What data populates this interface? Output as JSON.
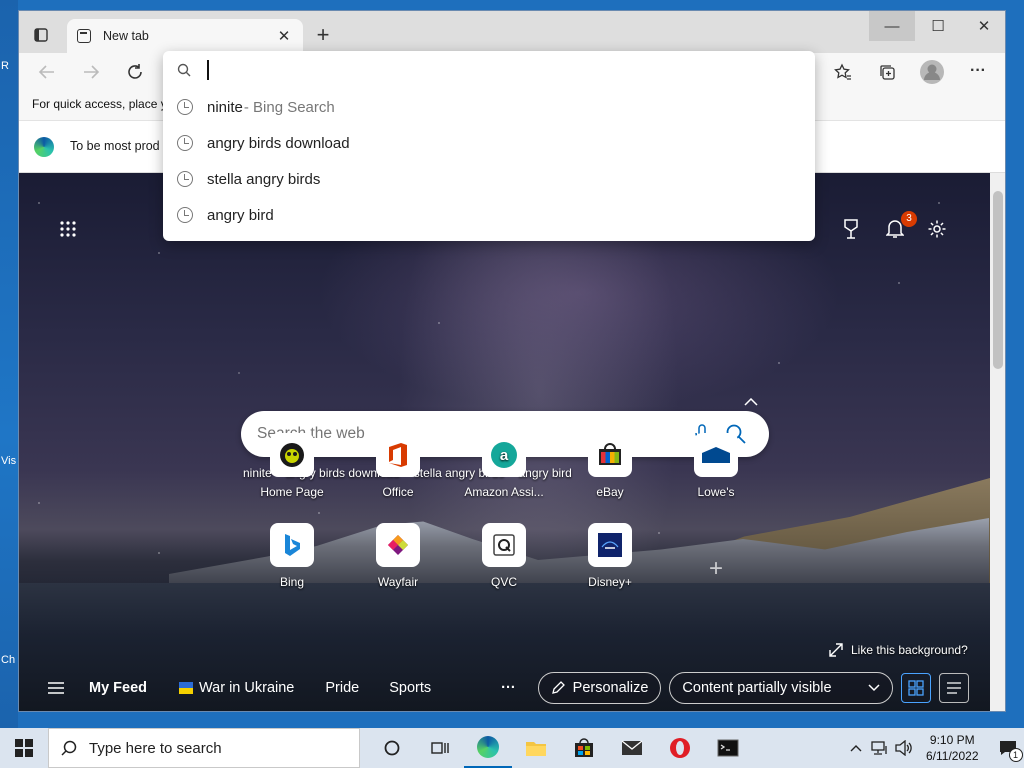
{
  "desktop": {
    "fragments": [
      "R",
      "I",
      "I",
      "I",
      "Vis",
      "I",
      "Ch"
    ]
  },
  "browser": {
    "tab": {
      "title": "New tab",
      "close": "✕"
    },
    "new_tab": "+",
    "window_controls": {
      "minimize": "—",
      "maximize": "☐",
      "close": "✕"
    },
    "address": {
      "value": "",
      "placeholder": ""
    },
    "favorites_bar_text": "For quick access, place y",
    "infobar_text": "To be most prod",
    "suggestions": [
      {
        "text": "ninite",
        "suffix": " - Bing Search"
      },
      {
        "text": "angry birds download",
        "suffix": ""
      },
      {
        "text": "stella angry birds",
        "suffix": ""
      },
      {
        "text": "angry bird",
        "suffix": ""
      }
    ],
    "toolbar_more": "···"
  },
  "newtab": {
    "notification_count": "3",
    "search_placeholder": "Search the web",
    "quick_searches": [
      "ninite",
      "angry birds download",
      "stella angry birds",
      "angry bird"
    ],
    "more": "···",
    "tiles_row1": [
      {
        "label": "Home Page",
        "icon": "home-page-icon"
      },
      {
        "label": "Office",
        "icon": "office-icon"
      },
      {
        "label": "Amazon Assi...",
        "icon": "amazon-icon"
      },
      {
        "label": "eBay",
        "icon": "ebay-icon"
      },
      {
        "label": "Lowe's",
        "icon": "lowes-icon"
      }
    ],
    "tiles_row2": [
      {
        "label": "Bing",
        "icon": "bing-icon"
      },
      {
        "label": "Wayfair",
        "icon": "wayfair-icon"
      },
      {
        "label": "QVC",
        "icon": "qvc-icon"
      },
      {
        "label": "Disney+",
        "icon": "disney-icon"
      }
    ],
    "add_tile": "+",
    "like_background": "Like this background?",
    "feed": {
      "my_feed": "My Feed",
      "tabs": [
        "War in Ukraine",
        "Pride",
        "Sports"
      ],
      "more": "···",
      "personalize": "Personalize",
      "content_visibility": "Content partially visible"
    }
  },
  "taskbar": {
    "search_placeholder": "Type here to search",
    "time": "9:10 PM",
    "date": "6/11/2022",
    "notification_count": "1"
  },
  "colors": {
    "accent": "#0067b8",
    "notification": "#d83b01"
  }
}
